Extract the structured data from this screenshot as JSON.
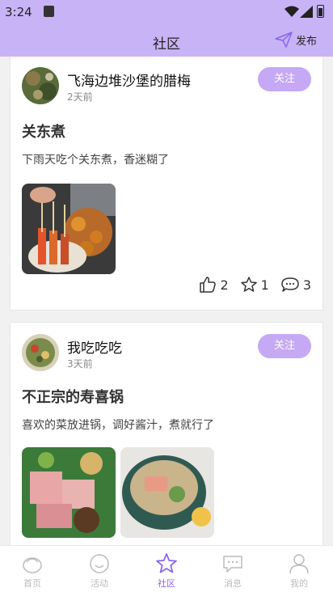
{
  "status": {
    "time": "3:24"
  },
  "header": {
    "title": "社区",
    "publish_label": "发布"
  },
  "posts": [
    {
      "username": "飞海边堆沙堡的腊梅",
      "time_ago": "2天前",
      "follow_label": "关注",
      "title": "关东煮",
      "body": "下雨天吃个关东煮，香迷糊了",
      "likes": "2",
      "favorites": "1",
      "comments": "3"
    },
    {
      "username": "我吃吃吃",
      "time_ago": "3天前",
      "follow_label": "关注",
      "title": "不正宗的寿喜锅",
      "body": "喜欢的菜放进锅，调好酱汁，煮就行了"
    }
  ],
  "tabs": [
    {
      "label": "首页",
      "icon": "home-icon"
    },
    {
      "label": "活动",
      "icon": "activity-icon"
    },
    {
      "label": "社区",
      "icon": "star-icon",
      "active": true
    },
    {
      "label": "消息",
      "icon": "message-icon"
    },
    {
      "label": "我的",
      "icon": "profile-icon"
    }
  ],
  "colors": {
    "accent": "#c9b3f7",
    "active_tab": "#8a65f0",
    "follow_button": "#c5a9f5"
  }
}
